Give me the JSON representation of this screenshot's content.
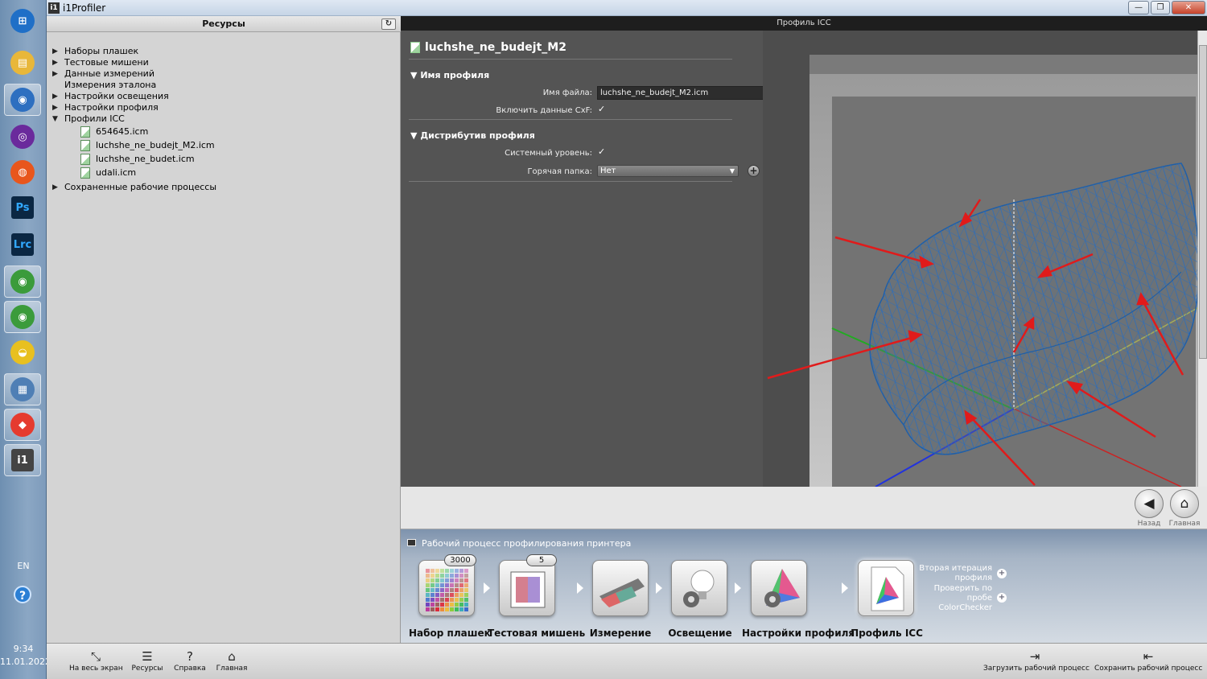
{
  "taskbar": {
    "lang": "EN",
    "time": "9:34",
    "date": "11.01.2022",
    "help_glyph": "?",
    "icons": [
      {
        "name": "start-orb-icon",
        "glyph": "⊞",
        "color": "#1f6fc7"
      },
      {
        "name": "file-explorer-icon",
        "glyph": "▤",
        "color": "#e8b73a"
      },
      {
        "name": "browser-globe-icon",
        "glyph": "◉",
        "color": "#2d6fc0"
      },
      {
        "name": "tor-browser-icon",
        "glyph": "◎",
        "color": "#6a2a9c"
      },
      {
        "name": "firefox-icon",
        "glyph": "◍",
        "color": "#e8561c"
      },
      {
        "name": "photoshop-icon",
        "glyph": "Ps",
        "color": "#0b2743"
      },
      {
        "name": "lightroom-classic-icon",
        "glyph": "Lrc",
        "color": "#0b2743"
      },
      {
        "name": "chrome-icon",
        "glyph": "◉",
        "color": "#3b9b3b"
      },
      {
        "name": "chrome-user-icon",
        "glyph": "◉",
        "color": "#3b9b3b"
      },
      {
        "name": "hardhat-icon",
        "glyph": "◒",
        "color": "#e8c020"
      },
      {
        "name": "calculator-icon",
        "glyph": "▦",
        "color": "#4f7fb5"
      },
      {
        "name": "anydesk-icon",
        "glyph": "◆",
        "color": "#e53b2f"
      },
      {
        "name": "i1profiler-icon",
        "glyph": "i1",
        "color": "#444444"
      }
    ]
  },
  "window": {
    "title": "i1Profiler",
    "minimize": "—",
    "restore": "❐",
    "close": "✕"
  },
  "resources": {
    "title": "Ресурсы",
    "refresh": "↻",
    "tree": [
      {
        "label": "Наборы плашек",
        "expanded": false
      },
      {
        "label": "Тестовые мишени",
        "expanded": false
      },
      {
        "label": "Данные измерений",
        "expanded": false
      },
      {
        "label": "Измерения эталона",
        "leaf": true
      },
      {
        "label": "Настройки освещения",
        "expanded": false
      },
      {
        "label": "Настройки профиля",
        "expanded": false
      },
      {
        "label": "Профили ICC",
        "expanded": true
      },
      {
        "label": "Сохраненные рабочие процессы",
        "expanded": false
      }
    ],
    "icc_files": [
      "654645.icm",
      "luchshe_ne_budejt_M2.icm",
      "luchshe_ne_budet.icm",
      "udali.icm"
    ],
    "arrow_collapsed": "▶",
    "arrow_expanded": "▼"
  },
  "main": {
    "header": "Профиль ICC",
    "profile_name": "luchshe_ne_budejt_M2",
    "section_name": {
      "title": "Имя профиля",
      "file_label": "Имя файла:",
      "file_value": "luchshe_ne_budejt_M2.icm",
      "cxf_label": "Включить данные CxF:",
      "cxf_checked": "✓"
    },
    "section_dist": {
      "title": "Дистрибутив профиля",
      "system_label": "Системный уровень:",
      "system_checked": "✓",
      "hotfolder_label": "Горячая папка:",
      "hotfolder_value": "Нет",
      "add": "+",
      "remove": "−"
    },
    "section_arrow": "▼"
  },
  "nav": {
    "back": "◀",
    "back_label": "Назад",
    "home": "⌂",
    "home_label": "Главная"
  },
  "workflow": {
    "title": "Рабочий процесс профилирования принтера",
    "steps": [
      {
        "label": "Набор плашек",
        "badge": "3000"
      },
      {
        "label": "Тестовая мишень",
        "badge": "5"
      },
      {
        "label": "Измерение"
      },
      {
        "label": "Освещение"
      },
      {
        "label": "Настройки профиля"
      },
      {
        "label": "Профиль ICC"
      }
    ],
    "link_second": "Вторая итерация профиля",
    "link_check": "Проверить по пробе ColorChecker",
    "plus": "+"
  },
  "bottom": {
    "fullscreen": "На весь экран",
    "fullscreen_icon": "⤡",
    "resources": "Ресурсы",
    "resources_icon": "☰",
    "help": "Справка",
    "help_icon": "?",
    "home": "Главная",
    "home_icon": "⌂",
    "load": "Загрузить рабочий процесс",
    "load_icon": "⇥",
    "save": "Сохранить рабочий процесс",
    "save_icon": "⇤"
  },
  "colors": {
    "gamut_mesh": "#1f5fa8",
    "annotation_arrow": "#e01b1b",
    "axis_green": "#22aa22",
    "axis_blue": "#2233dd",
    "axis_yellow": "#cccc44"
  }
}
